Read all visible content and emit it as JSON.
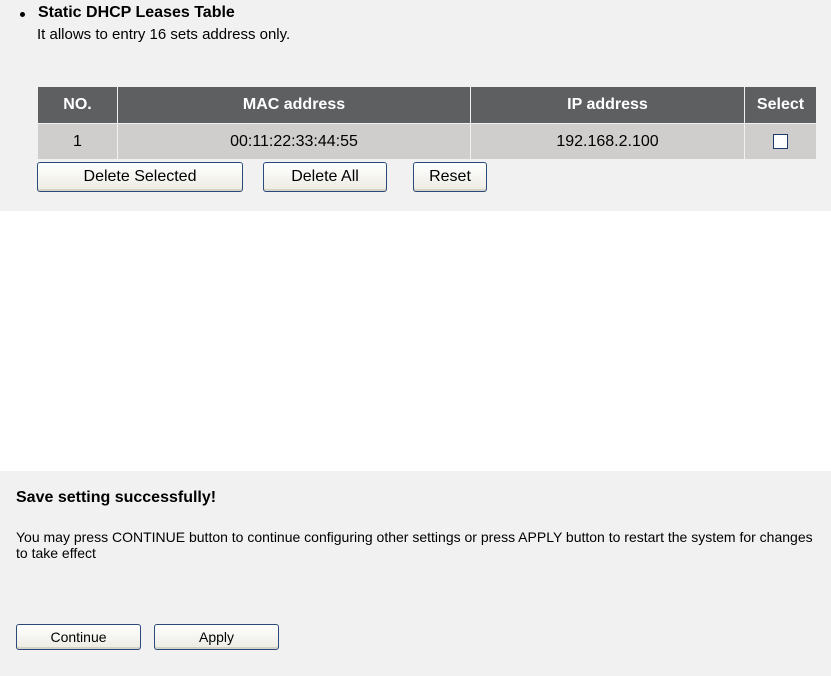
{
  "leases": {
    "title": "Static DHCP Leases Table",
    "note": "It allows to entry 16 sets address only.",
    "columns": [
      "NO.",
      "MAC address",
      "IP address",
      "Select"
    ],
    "rows": [
      {
        "no": "1",
        "mac": "00:11:22:33:44:55",
        "ip": "192.168.2.100",
        "selected": false
      }
    ],
    "buttons": {
      "delete_selected": "Delete Selected",
      "delete_all": "Delete All",
      "reset": "Reset"
    }
  },
  "result": {
    "title": "Save setting successfully!",
    "message": "You may press CONTINUE button to continue configuring other settings or press APPLY button to restart the system for changes to take effect",
    "buttons": {
      "continue": "Continue",
      "apply": "Apply"
    }
  }
}
